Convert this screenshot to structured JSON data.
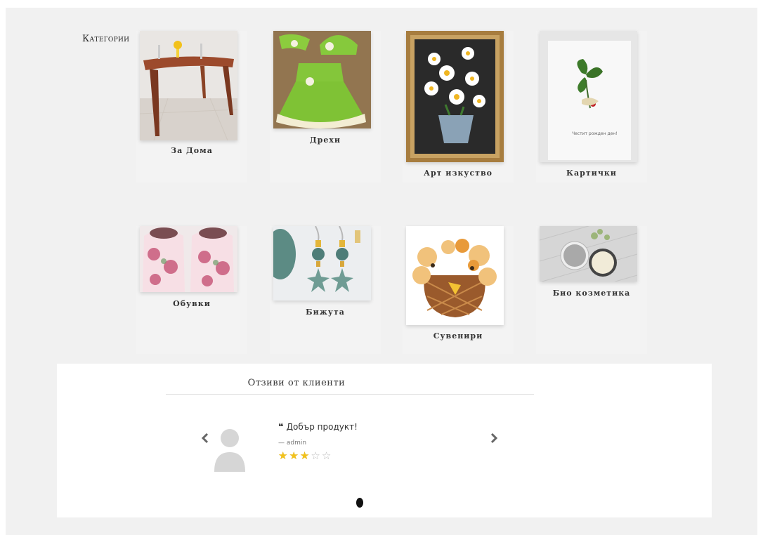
{
  "categories": {
    "heading": "Категории",
    "items": [
      {
        "label": "За Дома"
      },
      {
        "label": "Дрехи"
      },
      {
        "label": "Арт изкуство"
      },
      {
        "label": "Картички"
      },
      {
        "label": "Обувки"
      },
      {
        "label": "Бижута"
      },
      {
        "label": "Сувенири"
      },
      {
        "label": "Био козметика"
      }
    ]
  },
  "reviews": {
    "title": "Отзиви от клиенти",
    "quote_mark": "❝",
    "text": "Добър продукт!",
    "author": "— admin",
    "rating": 3,
    "max_rating": 5,
    "prev_icon": "chevron-left-icon",
    "next_icon": "chevron-right-icon"
  }
}
